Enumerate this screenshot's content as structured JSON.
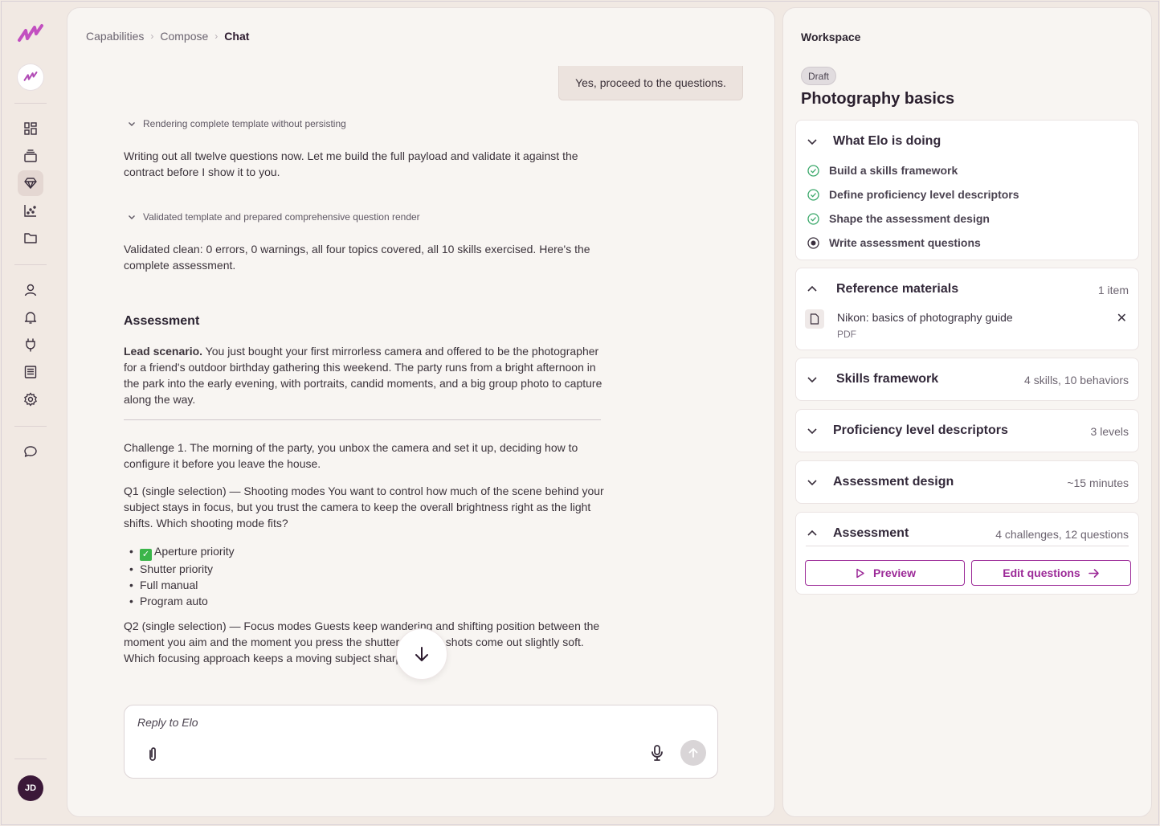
{
  "colors": {
    "accent": "#9c2a98",
    "rail_bg": "#f1e9e3",
    "panel_bg": "#f8f5f2",
    "user_avatar": "#3b1838",
    "check_green": "#3aa86a"
  },
  "rail": {
    "nav_icons": [
      "dashboard-icon",
      "stack-icon",
      "gem-icon",
      "chart-icon",
      "folder-icon"
    ],
    "nav_icons2": [
      "person-icon",
      "bell-icon",
      "plug-icon",
      "list-icon",
      "gear-icon"
    ],
    "chat_icon": "chat-icon",
    "user_initials": "JD"
  },
  "breadcrumb": [
    "Capabilities",
    "Compose",
    "Chat"
  ],
  "chat": {
    "user_message": "Yes, proceed to the questions.",
    "thought1": "Rendering complete template without persisting",
    "para1": "Writing out all twelve questions now. Let me build the full payload and validate it against the contract before I show it to you.",
    "thought2": "Validated template and prepared comprehensive question render",
    "para2": "Validated clean: 0 errors, 0 warnings, all four topics covered, all 10 skills exercised. Here's the complete assessment.",
    "assessment_heading": "Assessment",
    "lead_label": "Lead scenario.",
    "lead_text": " You just bought your first mirrorless camera and offered to be the photographer for a friend's outdoor birthday gathering this weekend. The party runs from a bright afternoon in the park into the early evening, with portraits, candid moments, and a big group photo to capture along the way.",
    "challenge1": "Challenge 1. The morning of the party, you unbox the camera and set it up, deciding how to configure it before you leave the house.",
    "q1": "Q1 (single selection) — Shooting modes You want to control how much of the scene behind your subject stays in focus, but you trust the camera to keep the overall brightness right as the light shifts. Which shooting mode fits?",
    "q1_options": [
      "Aperture priority",
      "Shutter priority",
      "Full manual",
      "Program auto"
    ],
    "q2": "Q2 (single selection) — Focus modes Guests keep wandering and shifting position between the moment you aim and the moment you press the shutter, and the shots come out slightly soft. Which focusing approach keeps a moving subject sharp?"
  },
  "composer": {
    "placeholder": "Reply to Elo"
  },
  "workspace": {
    "title": "Workspace",
    "badge": "Draft",
    "heading": "Photography basics",
    "doing": {
      "title": "What Elo is doing",
      "tasks": [
        {
          "label": "Build a skills framework",
          "status": "done"
        },
        {
          "label": "Define proficiency level descriptors",
          "status": "done"
        },
        {
          "label": "Shape the assessment design",
          "status": "done"
        },
        {
          "label": "Write assessment questions",
          "status": "in-progress"
        }
      ]
    },
    "reference": {
      "title": "Reference materials",
      "meta": "1 item",
      "file_name": "Nikon: basics of photography guide",
      "file_type": "PDF"
    },
    "skills": {
      "title": "Skills framework",
      "meta": "4 skills, 10 behaviors"
    },
    "proficiency": {
      "title": "Proficiency level descriptors",
      "meta": "3 levels"
    },
    "design": {
      "title": "Assessment design",
      "meta": "~15 minutes"
    },
    "assessment": {
      "title": "Assessment",
      "meta": "4 challenges, 12 questions",
      "preview_label": "Preview",
      "edit_label": "Edit questions"
    }
  }
}
